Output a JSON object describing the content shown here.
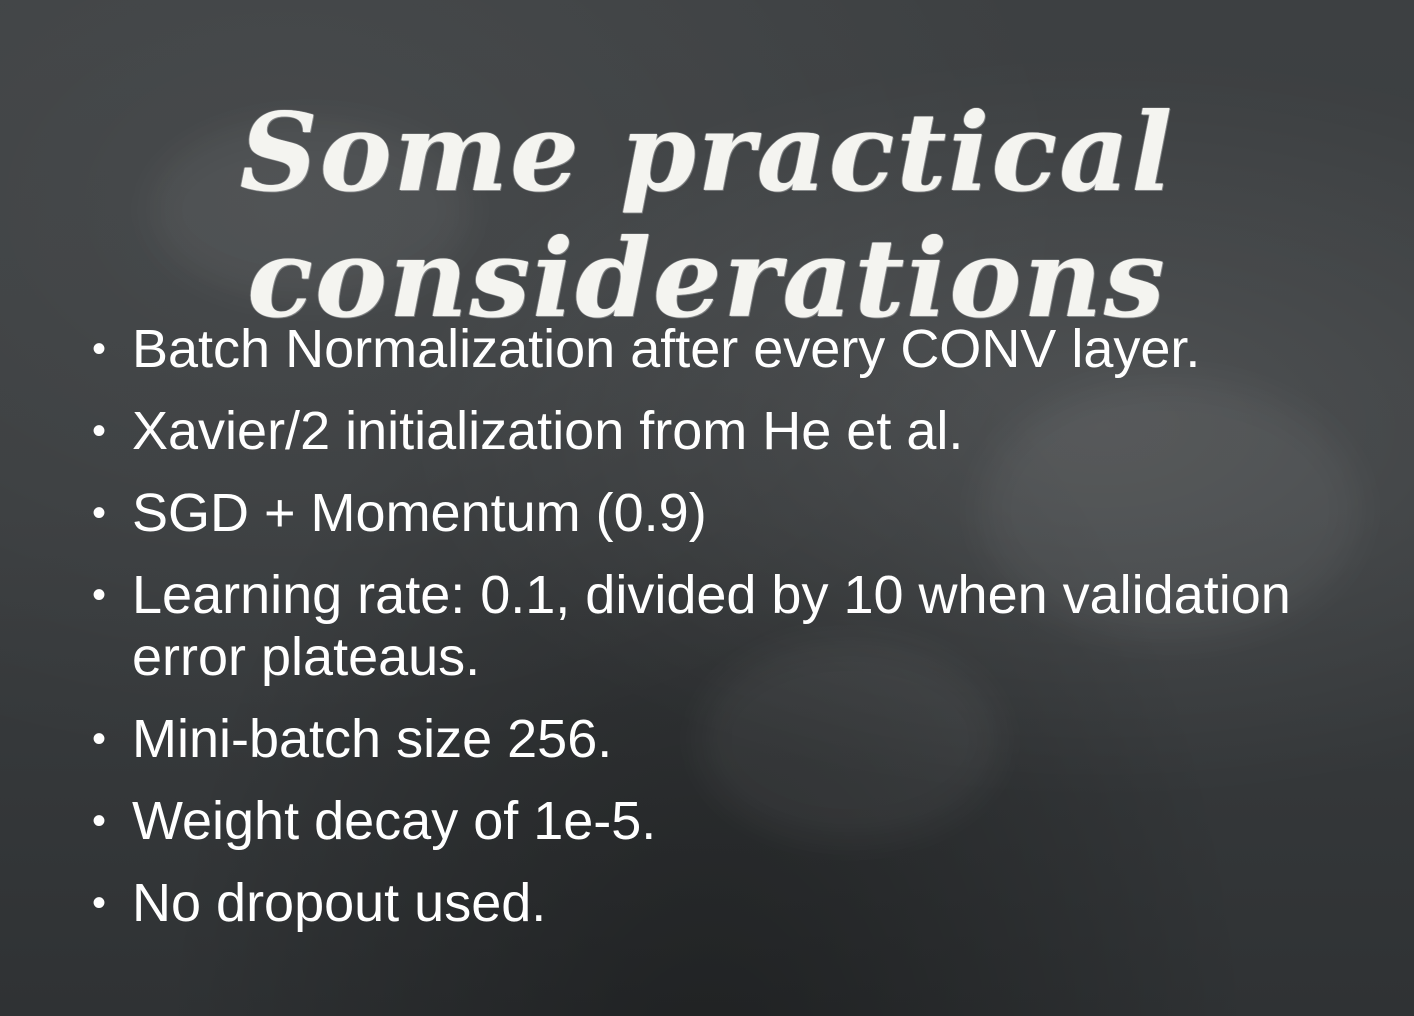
{
  "slide": {
    "title_lines": [
      "Some practical",
      "considerations"
    ],
    "bullet_glyph": "•",
    "bullets": [
      "Batch Normalization after every CONV layer.",
      "Xavier/2 initialization from He et al.",
      "SGD + Momentum (0.9)",
      "Learning rate: 0.1, divided by 10 when validation error plateaus.",
      "Mini-batch size 256.",
      "Weight decay of 1e-5.",
      "No dropout used."
    ]
  },
  "colors": {
    "background": "#3b3e40",
    "text": "#ffffff",
    "chalk": "#f4f4f0"
  }
}
